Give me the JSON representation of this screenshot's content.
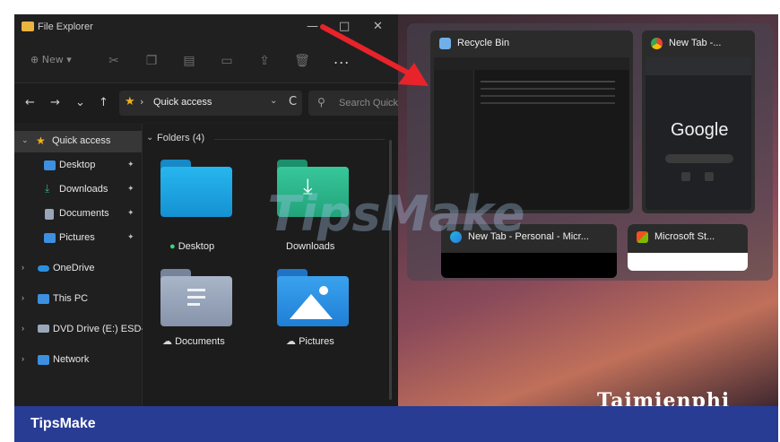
{
  "explorer": {
    "window_title": "File Explorer",
    "window_controls": {
      "minimize": "—",
      "maximize": "□",
      "close": "✕"
    },
    "toolbar": {
      "new_label": "New",
      "more_label": "..."
    },
    "nav": {
      "back": "←",
      "forward": "→",
      "recent": "⌄",
      "up": "↑",
      "refresh": "C"
    },
    "address": {
      "path": "Quick access",
      "separator": "›"
    },
    "search": {
      "placeholder": "Search Quick"
    },
    "sidebar": {
      "items": [
        {
          "label": "Quick access",
          "icon": "star-icon",
          "color": "#f2b01e",
          "selected": true
        },
        {
          "label": "Desktop",
          "icon": "desktop-icon",
          "color": "#3d8fe0",
          "pinned": true
        },
        {
          "label": "Downloads",
          "icon": "download-icon",
          "color": "#2fb370",
          "pinned": true
        },
        {
          "label": "Documents",
          "icon": "document-icon",
          "color": "#9aa6b8",
          "pinned": true
        },
        {
          "label": "Pictures",
          "icon": "pictures-icon",
          "color": "#3d8fe0",
          "pinned": true
        },
        {
          "label": "OneDrive",
          "icon": "cloud-icon",
          "color": "#2b8fe0"
        },
        {
          "label": "This PC",
          "icon": "pc-icon",
          "color": "#3d8fe0"
        },
        {
          "label": "DVD Drive (E:) ESD-",
          "icon": "dvd-icon",
          "color": "#9aa6b8"
        },
        {
          "label": "Network",
          "icon": "network-icon",
          "color": "#3d8fe0"
        }
      ]
    },
    "content": {
      "group_header": "Folders (4)",
      "folders": [
        {
          "label": "Desktop",
          "color": "#1aa6e0"
        },
        {
          "label": "Downloads",
          "color": "#2bb58a"
        },
        {
          "label": "Documents",
          "color": "#8e9bb0"
        },
        {
          "label": "Pictures",
          "color": "#2b8fe0"
        }
      ]
    }
  },
  "snap": {
    "cards": [
      {
        "title": "Recycle Bin",
        "icon": "recycle-bin-icon"
      },
      {
        "title": "New Tab -...",
        "icon": "chrome-icon"
      },
      {
        "title": "New Tab - Personal - Micr...",
        "icon": "edge-icon"
      },
      {
        "title": "Microsoft St...",
        "icon": "store-icon"
      }
    ],
    "google_text": "Google"
  },
  "watermarks": {
    "main": "TipsMake",
    "corner": "Taimienphi"
  },
  "footer": {
    "brand": "TipsMake"
  },
  "colors": {
    "accent_frame": "#263a8f",
    "arrow": "#e8232a"
  }
}
